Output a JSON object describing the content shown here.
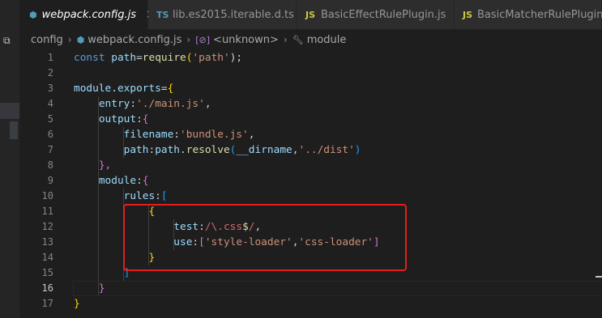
{
  "tabs": [
    {
      "label": "webpack.config.js",
      "icon": "webpack-icon",
      "active": true,
      "close": "×"
    },
    {
      "label": "lib.es2015.iterable.d.ts",
      "icon": "typescript-icon",
      "icon_text": "TS",
      "active": false
    },
    {
      "label": "BasicEffectRulePlugin.js",
      "icon": "javascript-icon",
      "icon_text": "JS",
      "active": false
    },
    {
      "label": "BasicMatcherRulePlugin.js",
      "icon": "javascript-icon",
      "icon_text": "JS",
      "active": false
    }
  ],
  "breadcrumb": {
    "folder": "config",
    "file": "webpack.config.js",
    "symbol1": "<unknown>",
    "symbol1_icon": "[⊘]",
    "symbol2": "module"
  },
  "line_numbers": [
    "1",
    "2",
    "3",
    "4",
    "5",
    "6",
    "7",
    "8",
    "9",
    "10",
    "11",
    "12",
    "13",
    "14",
    "15",
    "16",
    "17"
  ],
  "current_line": 16,
  "code": {
    "l1": {
      "a": "const",
      "b": "path",
      "c": "=",
      "d": "require",
      "e": "(",
      "f": "'path'",
      "g": ");"
    },
    "l3": {
      "a": "module",
      "b": ".",
      "c": "exports",
      "d": "=",
      "e": "{"
    },
    "l4": {
      "a": "entry",
      "b": ":",
      "c": "'./main.js'",
      "d": ","
    },
    "l5": {
      "a": "output",
      "b": ":",
      "c": "{"
    },
    "l6": {
      "a": "filename",
      "b": ":",
      "c": "'bundle.js'",
      "d": ","
    },
    "l7": {
      "a": "path",
      "b": ":",
      "c": "path",
      "d": ".",
      "e": "resolve",
      "f": "(",
      "g": "__dirname",
      "h": ",",
      "i": "'../dist'",
      "j": ")"
    },
    "l8": {
      "a": "},"
    },
    "l9": {
      "a": "module",
      "b": ":",
      "c": "{"
    },
    "l10": {
      "a": "rules",
      "b": ":",
      "c": "["
    },
    "l11": {
      "a": "{"
    },
    "l12": {
      "a": "test",
      "b": ":",
      "c": "/",
      "d": "\\.css",
      "e": "$",
      "f": "/",
      "g": ","
    },
    "l13": {
      "a": "use",
      "b": ":",
      "c": "[",
      "d": "'style-loader'",
      "e": ",",
      "f": "'css-loader'",
      "g": "]"
    },
    "l14": {
      "a": "}"
    },
    "l15": {
      "a": "]"
    },
    "l16": {
      "a": "}"
    },
    "l17": {
      "a": "}"
    }
  },
  "colors": {
    "keyword": "#569cd6",
    "variable": "#9cdcfe",
    "function": "#dcdcaa",
    "string": "#ce9178",
    "regex": "#d16969",
    "highlight_box": "#e41e1e"
  }
}
